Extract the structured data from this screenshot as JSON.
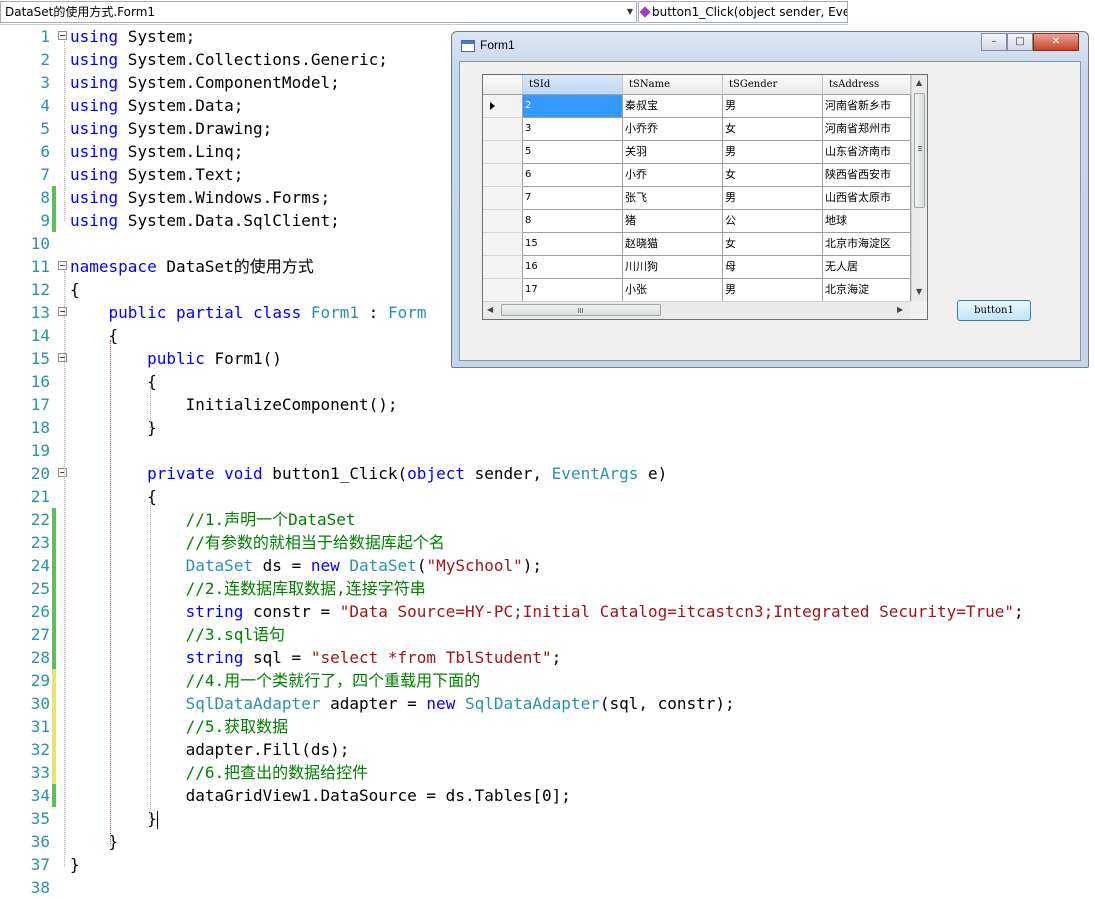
{
  "nav": {
    "class_dropdown": "DataSet的使用方式.Form1",
    "member_dropdown": "button1_Click(object sender, Eve"
  },
  "editor": {
    "line_numbers": [
      "1",
      "2",
      "3",
      "4",
      "5",
      "6",
      "7",
      "8",
      "9",
      "10",
      "11",
      "12",
      "13",
      "14",
      "15",
      "16",
      "17",
      "18",
      "19",
      "20",
      "21",
      "22",
      "23",
      "24",
      "25",
      "26",
      "27",
      "28",
      "29",
      "30",
      "31",
      "32",
      "33",
      "34",
      "35",
      "36",
      "37",
      "38"
    ],
    "lines": [
      [
        [
          "kw",
          "using"
        ],
        [
          "",
          " System;"
        ]
      ],
      [
        [
          "kw",
          "using"
        ],
        [
          "",
          " System.Collections.Generic;"
        ]
      ],
      [
        [
          "kw",
          "using"
        ],
        [
          "",
          " System.ComponentModel;"
        ]
      ],
      [
        [
          "kw",
          "using"
        ],
        [
          "",
          " System.Data;"
        ]
      ],
      [
        [
          "kw",
          "using"
        ],
        [
          "",
          " System.Drawing;"
        ]
      ],
      [
        [
          "kw",
          "using"
        ],
        [
          "",
          " System.Linq;"
        ]
      ],
      [
        [
          "kw",
          "using"
        ],
        [
          "",
          " System.Text;"
        ]
      ],
      [
        [
          "kw",
          "using"
        ],
        [
          "",
          " System.Windows.Forms;"
        ]
      ],
      [
        [
          "kw",
          "using"
        ],
        [
          "",
          " System.Data.SqlClient;"
        ]
      ],
      [],
      [
        [
          "kw",
          "namespace"
        ],
        [
          "",
          " DataSet的使用方式"
        ]
      ],
      [
        [
          "",
          "{"
        ]
      ],
      [
        [
          "",
          "    "
        ],
        [
          "kw",
          "public"
        ],
        [
          "",
          " "
        ],
        [
          "kw",
          "partial"
        ],
        [
          "",
          " "
        ],
        [
          "kw",
          "class"
        ],
        [
          "",
          " "
        ],
        [
          "ty",
          "Form1"
        ],
        [
          "",
          " : "
        ],
        [
          "ty",
          "Form"
        ]
      ],
      [
        [
          "",
          "    {"
        ]
      ],
      [
        [
          "",
          "        "
        ],
        [
          "kw",
          "public"
        ],
        [
          "",
          " Form1()"
        ]
      ],
      [
        [
          "",
          "        {"
        ]
      ],
      [
        [
          "",
          "            InitializeComponent();"
        ]
      ],
      [
        [
          "",
          "        }"
        ]
      ],
      [],
      [
        [
          "",
          "        "
        ],
        [
          "kw",
          "private"
        ],
        [
          "",
          " "
        ],
        [
          "kw",
          "void"
        ],
        [
          "",
          " button1_Click("
        ],
        [
          "kw",
          "object"
        ],
        [
          "",
          " sender, "
        ],
        [
          "ty",
          "EventArgs"
        ],
        [
          "",
          " e)"
        ]
      ],
      [
        [
          "",
          "        {"
        ]
      ],
      [
        [
          "",
          "            "
        ],
        [
          "cm",
          "//1.声明一个DataSet"
        ]
      ],
      [
        [
          "",
          "            "
        ],
        [
          "cm",
          "//有参数的就相当于给数据库起个名"
        ]
      ],
      [
        [
          "",
          "            "
        ],
        [
          "ty",
          "DataSet"
        ],
        [
          "",
          " ds = "
        ],
        [
          "kw",
          "new"
        ],
        [
          "",
          " "
        ],
        [
          "ty",
          "DataSet"
        ],
        [
          "",
          "("
        ],
        [
          "str",
          "\"MySchool\""
        ],
        [
          "",
          ");"
        ]
      ],
      [
        [
          "",
          "            "
        ],
        [
          "cm",
          "//2.连数据库取数据,连接字符串"
        ]
      ],
      [
        [
          "",
          "            "
        ],
        [
          "kw",
          "string"
        ],
        [
          "",
          " constr = "
        ],
        [
          "str",
          "\"Data Source=HY-PC;Initial Catalog=itcastcn3;Integrated Security=True\""
        ],
        [
          "",
          ";"
        ]
      ],
      [
        [
          "",
          "            "
        ],
        [
          "cm",
          "//3.sql语句"
        ]
      ],
      [
        [
          "",
          "            "
        ],
        [
          "kw",
          "string"
        ],
        [
          "",
          " sql = "
        ],
        [
          "str",
          "\"select *from TblStudent\""
        ],
        [
          "",
          ";"
        ]
      ],
      [
        [
          "",
          "            "
        ],
        [
          "cm",
          "//4.用一个类就行了，四个重载用下面的"
        ]
      ],
      [
        [
          "",
          "            "
        ],
        [
          "ty",
          "SqlDataAdapter"
        ],
        [
          "",
          " adapter = "
        ],
        [
          "kw",
          "new"
        ],
        [
          "",
          " "
        ],
        [
          "ty",
          "SqlDataAdapter"
        ],
        [
          "",
          "(sql, constr);"
        ]
      ],
      [
        [
          "",
          "            "
        ],
        [
          "cm",
          "//5.获取数据"
        ]
      ],
      [
        [
          "",
          "            adapter.Fill(ds);"
        ]
      ],
      [
        [
          "",
          "            "
        ],
        [
          "cm",
          "//6.把查出的数据给控件"
        ]
      ],
      [
        [
          "",
          "            dataGridView1.DataSource = ds.Tables[0];"
        ]
      ],
      [
        [
          "",
          "        }"
        ]
      ],
      [
        [
          "",
          "    }"
        ]
      ],
      [
        [
          "",
          "}"
        ]
      ],
      []
    ]
  },
  "form": {
    "title": "Form1",
    "minimize": "–",
    "maximize": "□",
    "close": "✕",
    "button_label": "button1",
    "grid": {
      "columns": [
        "tSId",
        "tSName",
        "tSGender",
        "tsAddress"
      ],
      "rows": [
        [
          "2",
          "秦叔宝",
          "男",
          "河南省新乡市"
        ],
        [
          "3",
          "小乔乔",
          "女",
          "河南省郑州市"
        ],
        [
          "5",
          "关羽",
          "男",
          "山东省济南市"
        ],
        [
          "6",
          "小乔",
          "女",
          "陕西省西安市"
        ],
        [
          "7",
          "张飞",
          "男",
          "山西省太原市"
        ],
        [
          "8",
          "猪",
          "公",
          "地球"
        ],
        [
          "15",
          "赵晓猫",
          "女",
          "北京市海淀区"
        ],
        [
          "16",
          "川川狗",
          "母",
          "无人居"
        ],
        [
          "17",
          "小张",
          "男",
          "北京海淀"
        ]
      ]
    }
  },
  "colors": {
    "keyword": "#0000ff",
    "type": "#2b91af",
    "string": "#a31515",
    "comment": "#008000",
    "change_saved": "#5cbf5c",
    "change_unsaved": "#e6e66a"
  }
}
